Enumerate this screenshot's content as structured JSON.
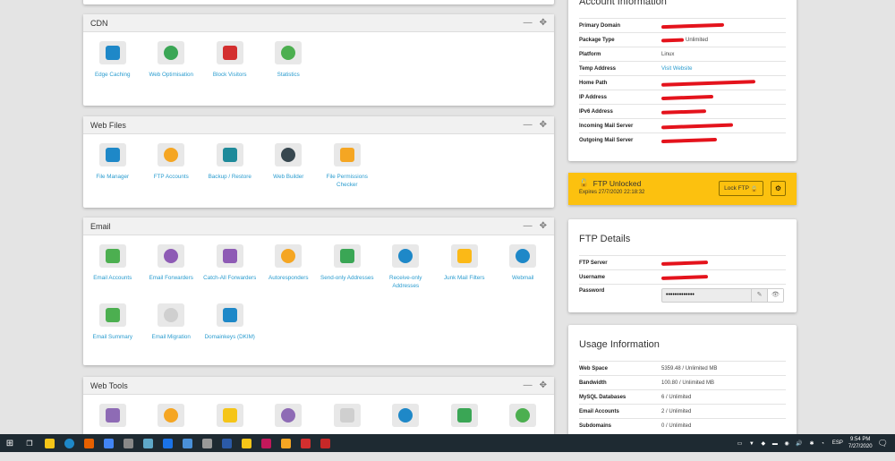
{
  "panels": [
    {
      "title": "CDN",
      "items": [
        {
          "label": "Edge Caching",
          "icon": "edge-caching-icon",
          "color": "#1e88c8"
        },
        {
          "label": "Web Optimisation",
          "icon": "speedometer-icon",
          "color": "#3aa655"
        },
        {
          "label": "Block Visitors",
          "icon": "block-icon",
          "color": "#d32f2f"
        },
        {
          "label": "Statistics",
          "icon": "statistics-icon",
          "color": "#4caf50"
        }
      ]
    },
    {
      "title": "Web Files",
      "items": [
        {
          "label": "File Manager",
          "icon": "folder-icon",
          "color": "#1e88c8"
        },
        {
          "label": "FTP Accounts",
          "icon": "ftp-folder-icon",
          "color": "#f5a623"
        },
        {
          "label": "Backup / Restore",
          "icon": "backup-icon",
          "color": "#1e8a9a"
        },
        {
          "label": "Web Builder",
          "icon": "web-builder-icon",
          "color": "#37474f"
        },
        {
          "label": "File Permissions Checker",
          "icon": "permissions-folder-icon",
          "color": "#f5a623"
        }
      ]
    },
    {
      "title": "Email",
      "items": [
        {
          "label": "Email Accounts",
          "icon": "email-accounts-icon",
          "color": "#4caf50"
        },
        {
          "label": "Email Forwarders",
          "icon": "email-forwarders-icon",
          "color": "#8e5bb5"
        },
        {
          "label": "Catch-All Forwarders",
          "icon": "catch-all-icon",
          "color": "#8e5bb5"
        },
        {
          "label": "Autoresponders",
          "icon": "autoresponder-icon",
          "color": "#f5a623"
        },
        {
          "label": "Send-only Addresses",
          "icon": "send-only-icon",
          "color": "#3aa655"
        },
        {
          "label": "Receive-only Addresses",
          "icon": "receive-only-icon",
          "color": "#1e88c8"
        },
        {
          "label": "Junk Mail Filters",
          "icon": "funnel-icon",
          "color": "#fbb917"
        },
        {
          "label": "Webmail",
          "icon": "webmail-icon",
          "color": "#1e88c8"
        },
        {
          "label": "Email Summary",
          "icon": "email-summary-icon",
          "color": "#4caf50"
        },
        {
          "label": "Email Migration",
          "icon": "paper-plane-icon",
          "color": "#cfcfcf"
        },
        {
          "label": "Domainkeys (DKIM)",
          "icon": "key-icon",
          "color": "#1e88c8"
        }
      ]
    },
    {
      "title": "Web Tools",
      "items": [
        {
          "label": "",
          "icon": "phpmyadmin-icon",
          "color": "#8e6bb5"
        },
        {
          "label": "",
          "icon": "database-icon",
          "color": "#f5a623"
        },
        {
          "label": "",
          "icon": "mysql-icon",
          "color": "#f5c518"
        },
        {
          "label": "",
          "icon": "php-icon",
          "color": "#8e6bb5"
        },
        {
          "label": "",
          "icon": "php-file-icon",
          "color": "#cfcfcf"
        },
        {
          "label": "",
          "icon": "calendar-icon",
          "color": "#1e88c8"
        },
        {
          "label": "",
          "icon": "redirect-icon",
          "color": "#3aa655"
        },
        {
          "label": "",
          "icon": "xml-file-icon",
          "color": "#4caf50"
        }
      ]
    }
  ],
  "account": {
    "title": "Account Information",
    "rows": [
      {
        "k": "Primary Domain",
        "v": ""
      },
      {
        "k": "Package Type",
        "v": "Unlimited"
      },
      {
        "k": "Platform",
        "v": "Linux"
      },
      {
        "k": "Temp Address",
        "v": "Visit Website",
        "link": true
      },
      {
        "k": "Home Path",
        "v": ""
      },
      {
        "k": "IP Address",
        "v": ""
      },
      {
        "k": "IPv6 Address",
        "v": ""
      },
      {
        "k": "Incoming Mail Server",
        "v": ""
      },
      {
        "k": "Outgoing Mail Server",
        "v": ""
      }
    ]
  },
  "ftp_status": {
    "title": "FTP Unlocked",
    "expires": "Expires 27/7/2020 22:18:32",
    "lock_label": "Lock FTP"
  },
  "ftp_details": {
    "title": "FTP Details",
    "server_label": "FTP Server",
    "username_label": "Username",
    "password_label": "Password",
    "password_value": "•••••••••••••"
  },
  "usage": {
    "title": "Usage Information",
    "rows": [
      {
        "k": "Web Space",
        "v": "5359.48 / Unlimited MB"
      },
      {
        "k": "Bandwidth",
        "v": "100.80 / Unlimited MB"
      },
      {
        "k": "MySQL Databases",
        "v": "6 / Unlimited"
      },
      {
        "k": "Email Accounts",
        "v": "2 / Unlimited"
      },
      {
        "k": "Subdomains",
        "v": "0 / Unlimited"
      }
    ]
  },
  "taskbar": {
    "lang": "ESP",
    "time": "9:54 PM",
    "date": "7/27/2020",
    "apps": [
      "#e66000",
      "#4285f4",
      "#888",
      "#5fa8c8",
      "#1a73e8",
      "#4a90d9",
      "#999",
      "#2b5aa8",
      "#f5c518",
      "#c2185b",
      "#f5a623",
      "#d32f2f",
      "#c62828"
    ]
  }
}
